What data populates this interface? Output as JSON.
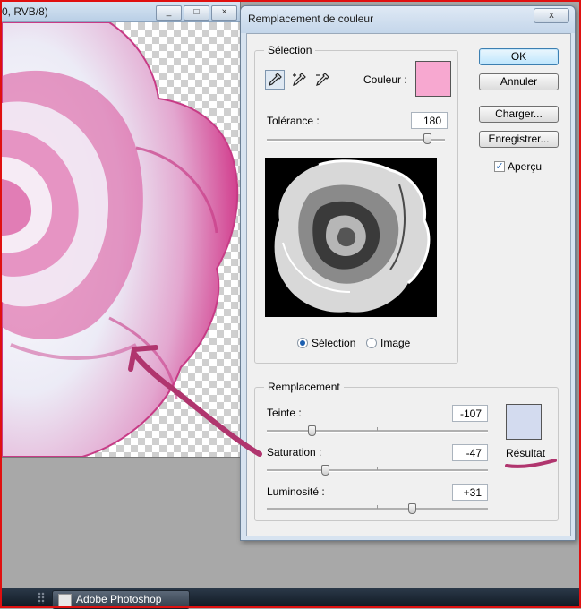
{
  "document": {
    "title": "0, RVB/8)",
    "window_buttons": [
      "_",
      "□",
      "×"
    ]
  },
  "taskbar": {
    "app_label": "Adobe Photoshop"
  },
  "dialog": {
    "title": "Remplacement de couleur",
    "close_symbol": "x",
    "selection": {
      "group_label": "Sélection",
      "color_label": "Couleur :",
      "color_value": "#f7a8d0",
      "tolerance_label": "Tolérance :",
      "tolerance_value": "180",
      "tolerance_level": 0.9,
      "radio_selection_label": "Sélection",
      "radio_image_label": "Image",
      "selected_radio": "Sélection"
    },
    "replacement": {
      "group_label": "Remplacement",
      "hue_label": "Teinte :",
      "hue_value": "-107",
      "saturation_label": "Saturation :",
      "saturation_value": "-47",
      "lightness_label": "Luminosité :",
      "lightness_value": "+31",
      "result_label": "Résultat",
      "result_color": "#d3dbef"
    },
    "buttons": {
      "ok": "OK",
      "cancel": "Annuler",
      "load": "Charger...",
      "save": "Enregistrer..."
    },
    "preview_checkbox": {
      "label": "Aperçu",
      "checked": true
    }
  },
  "colors": {
    "rose_pink": "#d63a8c",
    "rose_light": "#e6e3f3",
    "annotation": "#b0356e"
  },
  "icons": [
    "eyedropper-icon",
    "eyedropper-plus-icon",
    "eyedropper-minus-icon",
    "photoshop-icon",
    "checkmark-icon"
  ]
}
